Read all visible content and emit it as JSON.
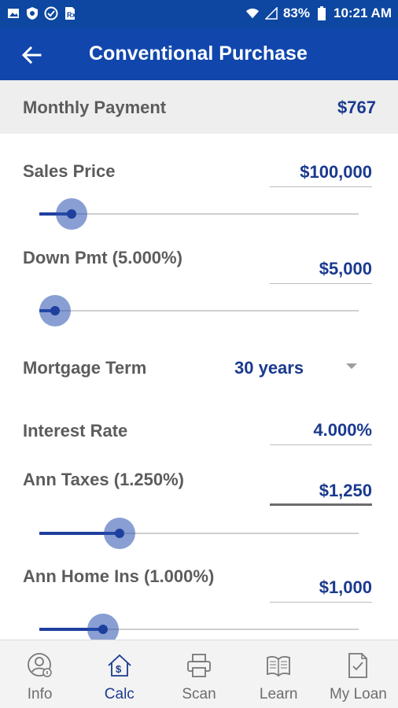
{
  "status_bar": {
    "battery": "83%",
    "time": "10:21 AM"
  },
  "app_bar": {
    "title": "Conventional Purchase"
  },
  "summary": {
    "label": "Monthly Payment",
    "value": "$767"
  },
  "fields": {
    "sales_price": {
      "label": "Sales Price",
      "value": "$100,000",
      "slider_fraction": 0.1
    },
    "down_pmt": {
      "label": "Down Pmt (5.000%)",
      "value": "$5,000",
      "slider_fraction": 0.05
    },
    "mortgage_term": {
      "label": "Mortgage Term",
      "value": "30 years"
    },
    "interest_rate": {
      "label": "Interest Rate",
      "value": "4.000%"
    },
    "ann_taxes": {
      "label": "Ann Taxes (1.250%)",
      "value": "$1,250",
      "slider_fraction": 0.25
    },
    "ann_home_ins": {
      "label": "Ann Home Ins (1.000%)",
      "value": "$1,000",
      "slider_fraction": 0.2
    }
  },
  "bottom_nav": [
    {
      "label": "Info",
      "icon": "person-info-icon"
    },
    {
      "label": "Calc",
      "icon": "house-dollar-icon",
      "active": true
    },
    {
      "label": "Scan",
      "icon": "printer-icon"
    },
    {
      "label": "Learn",
      "icon": "book-icon"
    },
    {
      "label": "My Loan",
      "icon": "document-check-icon"
    }
  ],
  "colors": {
    "primary": "#1147ad",
    "accent_text": "#1a3a8f",
    "slider": "#1f3f9f"
  }
}
